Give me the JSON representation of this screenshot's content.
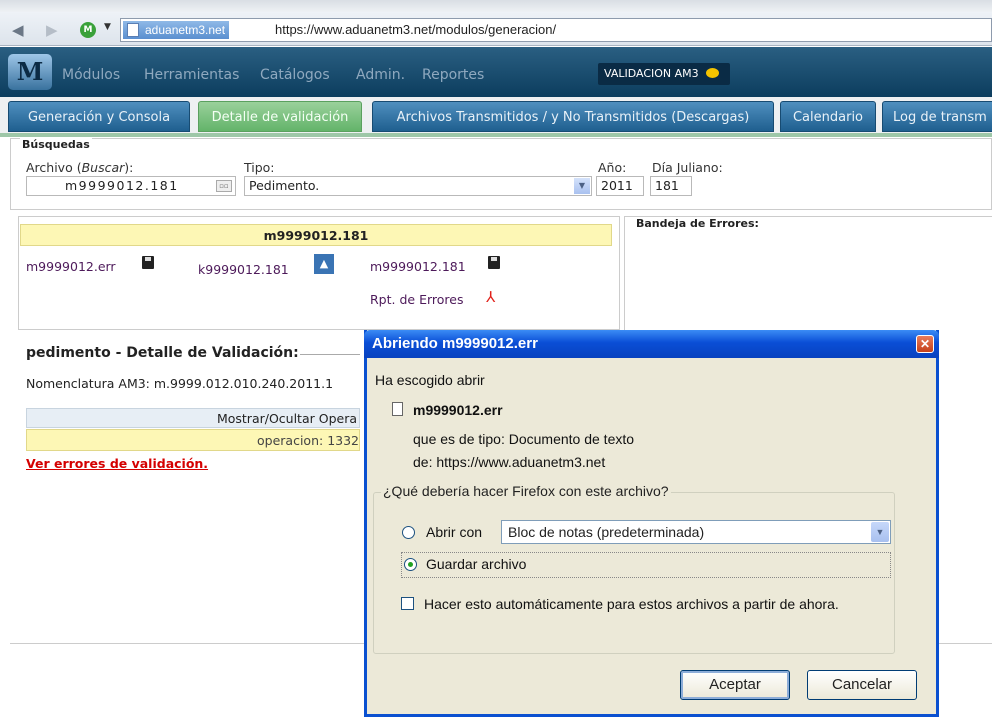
{
  "browser": {
    "domain": "aduanetm3.net",
    "url": "https://www.aduanetm3.net/modulos/generacion/",
    "site_letter": "M"
  },
  "app": {
    "logo": "M",
    "menu": [
      "Módulos",
      "Herramientas",
      "Catálogos",
      "Admin.",
      "Reportes"
    ],
    "status": "VALIDACION AM3"
  },
  "tabs": [
    "Generación y Consola",
    "Detalle de validación",
    "Archivos Transmitidos / y No Transmitidos (Descargas)",
    "Calendario",
    "Log de transm"
  ],
  "search": {
    "legend": "Búsquedas",
    "archivo_label_pre": "Archivo (",
    "archivo_label_em": "Buscar",
    "archivo_label_post": "):",
    "archivo_value": "m9999012.181",
    "tipo_label": "Tipo:",
    "tipo_value": "Pedimento.",
    "anio_label": "Año:",
    "anio_value": "2011",
    "juliano_label": "Día Juliano:",
    "juliano_value": "181"
  },
  "files": {
    "header": "m9999012.181",
    "err_link": "m9999012.err",
    "k_link": "k9999012.181",
    "m_link": "m9999012.181",
    "rpt_link": "Rpt. de Errores"
  },
  "bandeja": {
    "title": "Bandeja de Errores:"
  },
  "pedimento": {
    "title": "pedimento - Detalle de Validación:",
    "nomenclatura": "Nomenclatura AM3: m.9999.012.010.240.2011.1",
    "mostrar": "Mostrar/Ocultar Opera",
    "operacion": "operacion: 1332",
    "ver_errores": "Ver errores de validación."
  },
  "dialog": {
    "title": "Abriendo m9999012.err",
    "chosen": "Ha escogido abrir",
    "filename": "m9999012.err",
    "type_line": "que es de tipo:  Documento de texto",
    "from_line": "de:  https://www.aduanetm3.net",
    "question": "¿Qué debería hacer Firefox con este archivo?",
    "open_with": "Abrir con",
    "open_app": "Bloc de notas (predeterminada)",
    "save": "Guardar archivo",
    "auto": "Hacer esto automáticamente para estos archivos a partir de ahora.",
    "ok": "Aceptar",
    "cancel": "Cancelar"
  }
}
